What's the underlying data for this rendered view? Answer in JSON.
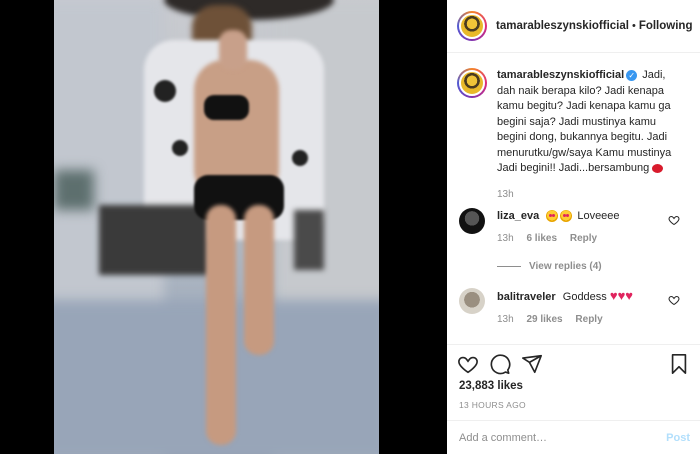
{
  "post": {
    "username": "tamarableszynskiofficial",
    "follow_status": "Following",
    "dot": "•",
    "caption": "Jadi, dah naik berapa kilo? Jadi kenapa kamu begitu? Jadi kenapa kamu ga begini saja? Jadi mustinya kamu begini dong, bukannya begitu. Jadi menurutku/gw/saya Kamu mustinya Jadi begini!! Jadi...bersambung",
    "caption_time": "13h"
  },
  "comments": [
    {
      "username": "liza_eva",
      "text": "Loveeee",
      "time": "13h",
      "likes": "6 likes",
      "reply": "Reply",
      "view_replies": "View replies (4)"
    },
    {
      "username": "balitraveler",
      "text": "Goddess",
      "hearts": "♥♥♥",
      "time": "13h",
      "likes": "29 likes",
      "reply": "Reply"
    }
  ],
  "actions": {
    "likes_count": "23,883 likes",
    "time_ago": "13 HOURS AGO"
  },
  "add_comment": {
    "placeholder": "Add a comment…",
    "post_label": "Post"
  },
  "icons": {
    "like": "heart-icon",
    "comment": "comment-icon",
    "share": "share-icon",
    "save": "bookmark-icon",
    "verified": "verified-badge-icon"
  },
  "colors": {
    "link_blue": "#3897f0",
    "heart_red": "#e0245e",
    "muted_text": "#8e8e8e"
  }
}
